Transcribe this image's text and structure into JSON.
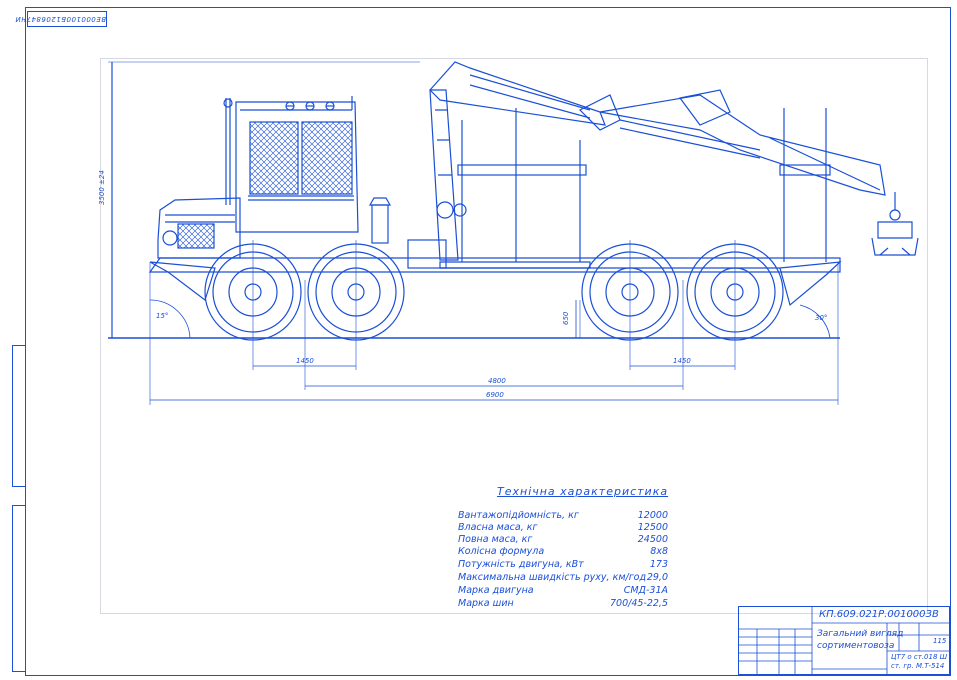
{
  "top_stamp": "ВЕ000100Б1206847ЧИ",
  "drawing": {
    "dim_height_total": "3500 ±24",
    "dim_clearance": "650",
    "dim_axle_front": "1450",
    "dim_axle_rear": "1450",
    "dim_base": "4800",
    "dim_overall": "6900",
    "angle_front": "15°",
    "angle_rear": "30°"
  },
  "specs": {
    "title": "Технічна характеристика",
    "rows": [
      {
        "label": "Вантажопідйомність,  кг",
        "value": "12000"
      },
      {
        "label": "Власна маса,  кг",
        "value": "12500"
      },
      {
        "label": "Повна маса,  кг",
        "value": "24500"
      },
      {
        "label": "Колісна формула",
        "value": "8х8"
      },
      {
        "label": "Потужність двигуна,  кВт",
        "value": "173"
      },
      {
        "label": "Максимальна швидкість руху, км/год",
        "value": "29,0"
      },
      {
        "label": "Марка двигуна",
        "value": "СМД-31А"
      },
      {
        "label": "Марка шин",
        "value": "700/45-22,5"
      }
    ]
  },
  "title_block": {
    "code": "КП.609.021Р.001000ЗВ",
    "title_line1": "Загальний вигляд",
    "title_line2": "сортиментовоза",
    "sheet": "115",
    "org_line1": "ЦТ7 о ст.018 Ш",
    "org_line2": "ст. гр. М.Т-514"
  },
  "colors": {
    "line": "#1a4fd6",
    "background": "#ffffff"
  }
}
